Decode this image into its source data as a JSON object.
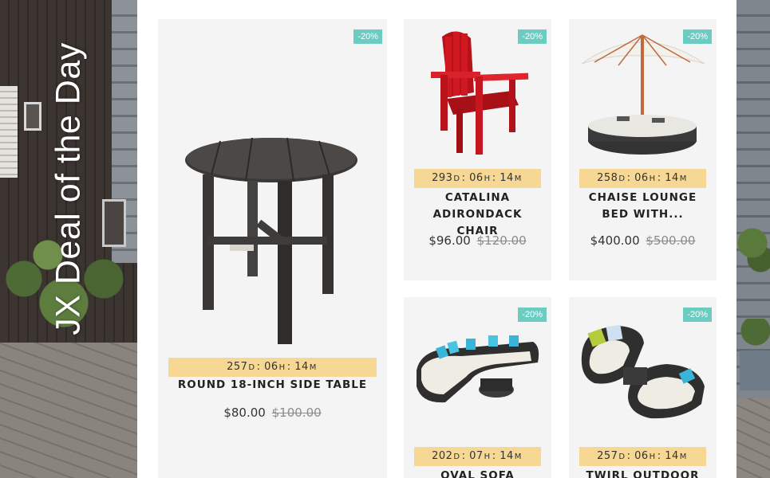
{
  "section": {
    "heading": "JX Deal of the Day"
  },
  "products": [
    {
      "title": "Round 18-Inch Side Table",
      "discount": "-20%",
      "countdown": {
        "days": "257",
        "hours": "06",
        "minutes": "14"
      },
      "price": "$80.00",
      "old_price": "$100.00",
      "image_icon": "side-table-image"
    },
    {
      "title": "Catalina Adirondack Chair",
      "discount": "-20%",
      "countdown": {
        "days": "293",
        "hours": "06",
        "minutes": "14"
      },
      "price": "$96.00",
      "old_price": "$120.00",
      "image_icon": "adirondack-chair-image"
    },
    {
      "title": "Chaise Lounge Bed With...",
      "discount": "-20%",
      "countdown": {
        "days": "258",
        "hours": "06",
        "minutes": "14"
      },
      "price": "$400.00",
      "old_price": "$500.00",
      "image_icon": "lounge-bed-umbrella-image"
    },
    {
      "title": "Oval Sofa",
      "discount": "-20%",
      "countdown": {
        "days": "202",
        "hours": "07",
        "minutes": "14"
      },
      "image_icon": "oval-sofa-image"
    },
    {
      "title": "Twirl Outdoor",
      "discount": "-20%",
      "countdown": {
        "days": "257",
        "hours": "06",
        "minutes": "14"
      },
      "image_icon": "twirl-outdoor-image"
    }
  ],
  "countdown_units": {
    "days": "D",
    "hours": "H",
    "minutes": "M"
  },
  "colors": {
    "badge": "#6dccc2",
    "countdown_bg": "#f7d794",
    "card_bg": "#f4f4f4"
  }
}
